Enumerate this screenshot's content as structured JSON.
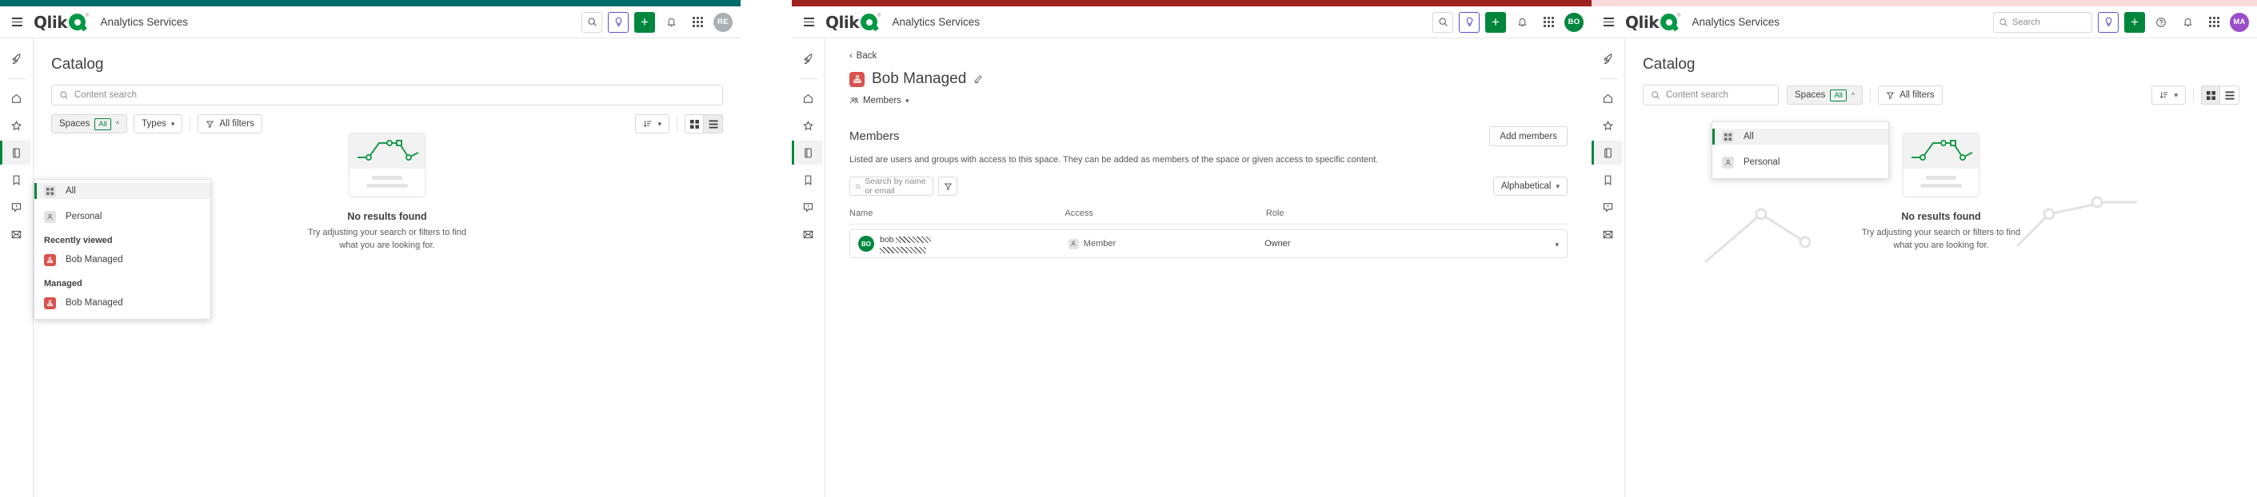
{
  "app": {
    "brand": "Qlik",
    "title": "Analytics Services"
  },
  "panels": [
    {
      "id": "panel-catalog-dropdown",
      "accent_strip": "#006b68",
      "header": {
        "avatar_initials": "RE",
        "avatar_color": "#aab0b3",
        "has_search_icon": true,
        "has_search_field": false,
        "has_help_icon": false
      },
      "page_title": "Catalog",
      "search_placeholder": "Content search",
      "filters": {
        "spaces_label": "Spaces",
        "spaces_badge": "All",
        "types_label": "Types",
        "all_filters_label": "All filters"
      },
      "view_selected": "list",
      "spaces_dropdown": {
        "items": [
          {
            "label": "All",
            "icon": "grid-icon",
            "selected": true
          },
          {
            "label": "Personal",
            "icon": "person-icon",
            "selected": false
          }
        ],
        "groups": [
          {
            "heading": "Recently viewed",
            "items": [
              {
                "label": "Bob Managed",
                "icon": "managed-space-icon"
              }
            ]
          },
          {
            "heading": "Managed",
            "items": [
              {
                "label": "Bob Managed",
                "icon": "managed-space-icon"
              }
            ]
          }
        ]
      },
      "empty_state": {
        "title": "No results found",
        "subtitle": "Try adjusting your search or filters to find what you are looking for."
      }
    },
    {
      "id": "panel-space-members",
      "accent_strip": "#9e2320",
      "header": {
        "avatar_initials": "BO",
        "avatar_color": "#00873d",
        "has_search_icon": true,
        "has_search_field": false,
        "has_help_icon": false
      },
      "back_label": "Back",
      "space_name": "Bob Managed",
      "members_dropdown_label": "Members",
      "section": {
        "title": "Members",
        "add_button": "Add members",
        "description": "Listed are users and groups with access to this space. They can be added as members of the space or given access to specific content.",
        "search_placeholder": "Search by name or email",
        "sort_label": "Alphabetical"
      },
      "table": {
        "columns": [
          "Name",
          "Access",
          "Role",
          ""
        ],
        "rows": [
          {
            "avatar_initials": "BO",
            "name": "bob",
            "name_redacted": true,
            "access": "Member",
            "role": "Owner"
          }
        ]
      }
    },
    {
      "id": "panel-catalog-empty",
      "accent_strip": "#fadadd",
      "header": {
        "avatar_initials": "MA",
        "avatar_color": "#9b4dca",
        "has_search_icon": false,
        "has_search_field": true,
        "search_placeholder": "Search",
        "has_help_icon": true
      },
      "page_title": "Catalog",
      "search_placeholder": "Content search",
      "filters": {
        "spaces_label": "Spaces",
        "spaces_badge": "All",
        "all_filters_label": "All filters"
      },
      "view_selected": "grid",
      "spaces_dropdown": {
        "items": [
          {
            "label": "All",
            "icon": "grid-icon",
            "selected": true
          },
          {
            "label": "Personal",
            "icon": "person-icon",
            "selected": false
          }
        ]
      },
      "empty_state": {
        "title": "No results found",
        "subtitle": "Try adjusting your search or filters to find what you are looking for."
      }
    }
  ],
  "sidebar": {
    "items": [
      {
        "name": "rocket",
        "label": "Get started"
      },
      {
        "name": "home",
        "label": "Home"
      },
      {
        "name": "star",
        "label": "Favorites"
      },
      {
        "name": "catalog",
        "label": "Catalog"
      },
      {
        "name": "collections",
        "label": "Collections"
      },
      {
        "name": "alerts",
        "label": "Alerts"
      },
      {
        "name": "subscriptions",
        "label": "Subscriptions"
      }
    ]
  }
}
